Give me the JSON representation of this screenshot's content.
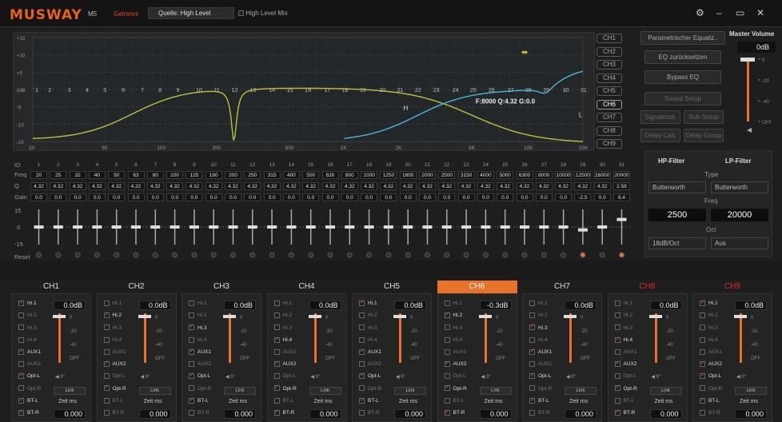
{
  "header": {
    "logo": "MUSWAY",
    "model": "M5",
    "mode": "Getrennt",
    "source_label": "Quelle: High Level",
    "high_level_mix": "High Level Mix"
  },
  "graph": {
    "y_ticks": [
      "+15",
      "+10",
      "+5",
      "0dB",
      "-5",
      "-10",
      "-15"
    ],
    "x_ticks": [
      "20",
      "50",
      "100",
      "200",
      "500",
      "1K",
      "2K",
      "5K",
      "10K",
      "20K"
    ],
    "readout": "F:8000 Q:4.32 G:0.0",
    "point_ids": [
      "1",
      "2",
      "3",
      "4",
      "5",
      "6",
      "7",
      "8",
      "9",
      "10",
      "11",
      "12",
      "13",
      "14",
      "15",
      "16",
      "17",
      "18",
      "19",
      "20",
      "21",
      "22",
      "23",
      "24",
      "25",
      "26",
      "27",
      "28",
      "29",
      "30",
      "31"
    ],
    "markers": {
      "h": "H",
      "l": "L"
    }
  },
  "channel_buttons": [
    "CH1",
    "CH2",
    "CH3",
    "CH4",
    "CH5",
    "CH6",
    "CH7",
    "CH8",
    "CH9"
  ],
  "right_buttons": {
    "peq": "Parametrischer Equaliz..",
    "eq_reset": "EQ zurücksetzen",
    "bypass": "Bypass EQ",
    "sound_setup": "Sound Setup",
    "signal_routing": "Signalrouti.",
    "sub_setup": "Sub Setup",
    "delay_calc": "Delay Calc",
    "delay_group": "Delay Group"
  },
  "master": {
    "title": "Master Volume",
    "value": "0dB",
    "scale": [
      "0",
      "-20",
      "-40",
      "OFF"
    ]
  },
  "eq": {
    "labels": {
      "id": "ID",
      "freq": "Freq",
      "q": "Q",
      "gain": "Gain",
      "reset": "Reset"
    },
    "slider_scale": [
      "15",
      "0",
      "-15"
    ],
    "ids": [
      "1",
      "2",
      "3",
      "4",
      "5",
      "6",
      "7",
      "8",
      "9",
      "10",
      "11",
      "12",
      "13",
      "14",
      "15",
      "16",
      "17",
      "18",
      "19",
      "20",
      "21",
      "22",
      "23",
      "24",
      "25",
      "26",
      "27",
      "28",
      "29",
      "30",
      "31"
    ],
    "freqs": [
      "20",
      "25",
      "32",
      "40",
      "50",
      "63",
      "80",
      "100",
      "125",
      "160",
      "200",
      "250",
      "315",
      "400",
      "500",
      "630",
      "800",
      "1000",
      "1250",
      "1600",
      "2000",
      "2500",
      "3150",
      "4000",
      "5000",
      "6300",
      "8000",
      "10000",
      "12500",
      "16000",
      "20000"
    ],
    "q": [
      "4.32",
      "4.32",
      "4.32",
      "4.32",
      "4.32",
      "4.32",
      "4.32",
      "4.32",
      "4.32",
      "4.32",
      "4.32",
      "4.32",
      "4.32",
      "4.32",
      "4.32",
      "4.32",
      "4.32",
      "4.32",
      "4.32",
      "4.32",
      "4.32",
      "4.32",
      "4.32",
      "4.32",
      "4.32",
      "4.32",
      "4.32",
      "4.32",
      "4.32",
      "4.32",
      "2.58"
    ],
    "gain": [
      "0.0",
      "0.0",
      "0.0",
      "0.0",
      "0.0",
      "0.0",
      "0.0",
      "0.0",
      "0.0",
      "0.0",
      "0.0",
      "0.0",
      "0.0",
      "0.0",
      "0.0",
      "0.0",
      "0.0",
      "0.0",
      "0.0",
      "0.0",
      "0.0",
      "0.0",
      "0.0",
      "0.0",
      "0.0",
      "0.0",
      "0.0",
      "0.0",
      "-2.5",
      "0.0",
      "6.4"
    ],
    "gain_values": [
      0,
      0,
      0,
      0,
      0,
      0,
      0,
      0,
      0,
      0,
      0,
      0,
      0,
      0,
      0,
      0,
      0,
      0,
      0,
      0,
      0,
      0,
      0,
      0,
      0,
      0,
      0,
      0,
      -2.5,
      0,
      6.4
    ]
  },
  "filter": {
    "hp": "HP-Filter",
    "lp": "LP-Filter",
    "type_label": "Type",
    "hp_type": "Butterworth",
    "lp_type": "Butterworth",
    "freq_label": "Freq",
    "hp_freq": "2500",
    "lp_freq": "20000",
    "oct_label": "Oct",
    "hp_oct": "18dB/Oct",
    "lp_oct": "Aus"
  },
  "channels": [
    {
      "name": "CH1",
      "gain": "0.0dB",
      "time": "0.000",
      "checks": [
        true,
        false,
        false,
        false,
        true,
        false,
        true,
        false,
        true,
        true
      ],
      "color": "normal"
    },
    {
      "name": "CH2",
      "gain": "0.0dB",
      "time": "0.000",
      "checks": [
        false,
        true,
        false,
        false,
        false,
        true,
        false,
        true,
        false,
        false
      ],
      "color": "normal"
    },
    {
      "name": "CH3",
      "gain": "0.0dB",
      "time": "0.000",
      "checks": [
        false,
        false,
        true,
        false,
        true,
        false,
        true,
        false,
        true,
        false
      ],
      "color": "normal"
    },
    {
      "name": "CH4",
      "gain": "0.0dB",
      "time": "0.000",
      "checks": [
        false,
        false,
        false,
        true,
        false,
        true,
        false,
        true,
        false,
        true
      ],
      "color": "normal"
    },
    {
      "name": "CH5",
      "gain": "0.0dB",
      "time": "0.000",
      "checks": [
        true,
        false,
        false,
        false,
        true,
        false,
        true,
        false,
        true,
        false
      ],
      "color": "normal"
    },
    {
      "name": "CH6",
      "gain": "-0.3dB",
      "time": "0.000",
      "checks": [
        false,
        true,
        false,
        false,
        false,
        true,
        false,
        true,
        false,
        true
      ],
      "color": "selected"
    },
    {
      "name": "CH7",
      "gain": "0.0dB",
      "time": "0.000",
      "checks": [
        false,
        false,
        true,
        false,
        true,
        false,
        true,
        false,
        true,
        false
      ],
      "color": "normal"
    },
    {
      "name": "CH8",
      "gain": "0.0dB",
      "time": "0.000",
      "checks": [
        false,
        false,
        false,
        true,
        false,
        true,
        false,
        true,
        false,
        true
      ],
      "color": "red"
    },
    {
      "name": "CH9",
      "gain": "0.0dB",
      "time": "0.000",
      "checks": [
        true,
        false,
        false,
        false,
        false,
        true,
        true,
        false,
        true,
        false
      ],
      "color": "red"
    }
  ],
  "channel_labels": {
    "inputs": [
      "Hi.1",
      "Hi.2",
      "Hi.3",
      "Hi.4",
      "AUX1",
      "AUX2",
      "Opt-L",
      "Opt-R",
      "BT-L",
      "BT-R"
    ],
    "scale": [
      "0",
      "-20",
      "-40",
      "OFF"
    ],
    "mute": "0°",
    "link": "Link",
    "zeit": "Zeit",
    "unit": "ms"
  },
  "colors": {
    "accent": "#e8722a",
    "curve_yellow": "#b8c23a",
    "curve_cyan": "#4ab8d8",
    "red": "#e02828"
  }
}
